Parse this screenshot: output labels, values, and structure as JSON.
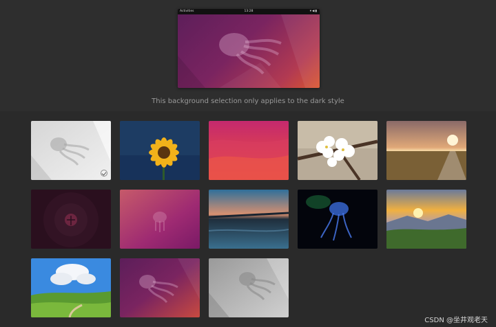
{
  "preview": {
    "topbar": {
      "activities": "Activities",
      "clock": "13:28",
      "tray_icons": [
        "network-icon",
        "volume-icon",
        "battery-icon"
      ]
    }
  },
  "caption": "This background selection only applies to the dark style",
  "wallpapers": [
    {
      "name": "jellyfish-light",
      "selected": true
    },
    {
      "name": "sunflower",
      "selected": false
    },
    {
      "name": "pink-waves",
      "selected": false
    },
    {
      "name": "cherry-blossom",
      "selected": false
    },
    {
      "name": "sunset-boardwalk",
      "selected": false
    },
    {
      "name": "dark-ubuntu-logo",
      "selected": false
    },
    {
      "name": "purple-jellyfish-faint",
      "selected": false
    },
    {
      "name": "lake-reflection",
      "selected": false
    },
    {
      "name": "blue-jellyfish-dark",
      "selected": false
    },
    {
      "name": "mountain-sunset",
      "selected": false
    },
    {
      "name": "green-hills-sky",
      "selected": false
    },
    {
      "name": "jellyfish-purple",
      "selected": false
    },
    {
      "name": "jellyfish-grey",
      "selected": false
    }
  ],
  "watermark": "CSDN @坐井观老天",
  "colors": {
    "background": "#2a2a2a",
    "accent": "#e95420",
    "caption": "#9a9a9a"
  }
}
